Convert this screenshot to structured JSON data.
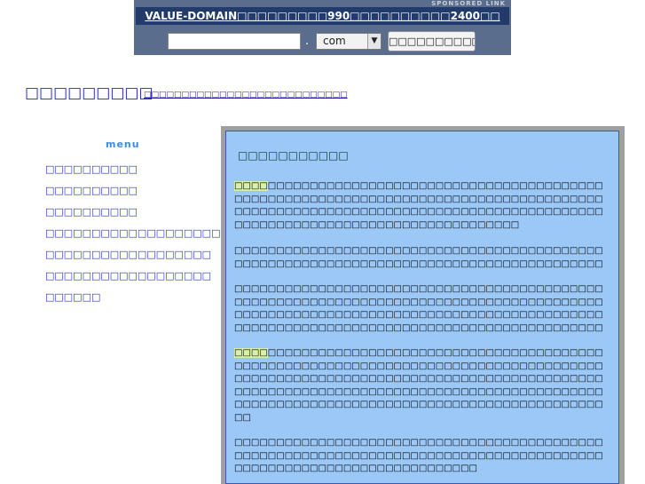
{
  "sponsor": {
    "tag": "SPONSORED LINK",
    "headline": "VALUE-DOMAIN□□□□□□□□□990□□□□□□□□□□2400□□",
    "input_value": "",
    "dot": ".",
    "tld_selected": "com",
    "tld_arrow": "▼",
    "search_label": "□□□□□□□□□□□□!!"
  },
  "header": {
    "site_title": "□□□□□□□□□",
    "tagline": "□□□□□□□□□□□□□□□□□□□□□□□□□□□"
  },
  "menu": {
    "heading": "menu",
    "items": [
      "□□□□□□□□□□",
      "□□□□□□□□□□",
      "□□□□□□□□□□",
      "□□□□□□□□□□□□□□□□□□□□",
      "□□□□□□□□□□□□□□□□□□",
      "□□□□□□□□□□□□□□□□□□",
      "□□□□□□"
    ]
  },
  "content": {
    "title": "□□□□□□□□□□□",
    "p1_highlight": "□□□□",
    "p1": "□□□□□□□□□□□□□□□□□□□□□□□□□□□□□□□□□□□□□□□□□□□□□□□□□□□□□□□□□□□□□□□□□□□□□□□□□□□□□□□□□□□□□□□□□□□□□□□□□□□□□□□□□□□□□□□□□□□□□□□□□□□□□□□□□□□□□□□□□□□□□□□□□□□□□□□□□□□□□□□□□□",
    "p2": "□□□□□□□□□□□□□□□□□□□□□□□□□□□□□□□□□□□□□□□□□□□□□□□□□□□□□□□□□□□□□□□□□□□□□□□□□□□□□□□□□□□□□□□□□□□□□□□□□□□□□□□□□□",
    "p3": "□□□□□□□□□□□□□□□□□□□□□□□□□□□□□□□□□□□□□□□□□□□□□□□□□□□□□□□□□□□□□□□□□□□□□□□□□□□□□□□□□□□□□□□□□□□□□□□□□□□□□□□□□□□□□□□□□□□□□□□□□□□□□□□□□□□□□□□□□□□□□□□□□□□□□□□□□□□□□□□□□□□□□□□□□□□□□□□□□□□□□□□□□□",
    "p4_highlight": "□□□□",
    "p4": "□□□□□□□□□□□□□□□□□□□□□□□□□□□□□□□□□□□□□□□□□□□□□□□□□□□□□□□□□□□□□□□□□□□□□□□□□□□□□□□□□□□□□□□□□□□□□□□□□□□□□□□□□□□□□□□□□□□□□□□□□□□□□□□□□□□□□□□□□□□□□□□□□□□□□□□□□□□□□□□□□□□□□□□□□□□□□□□□□□□□□□□□□□□□□□□□□□□□□□□□□□□□□□□□□□□□□□□□□□",
    "p5": "□□□□□□□□□□□□□□□□□□□□□□□□□□□□□□□□□□□□□□□□□□□□□□□□□□□□□□□□□□□□□□□□□□□□□□□□□□□□□□□□□□□□□□□□□□□□□□□□□□□□□□□□□□□□□□□□□□□□□"
  }
}
